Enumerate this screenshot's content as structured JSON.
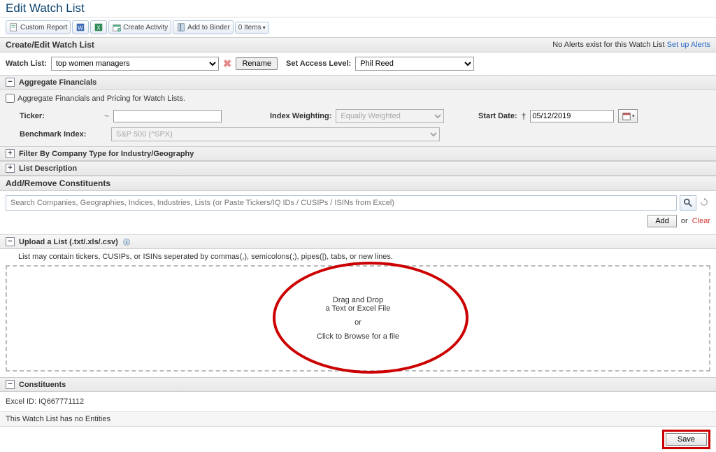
{
  "page": {
    "title": "Edit Watch List"
  },
  "toolbar": {
    "custom_report": "Custom Report",
    "create_activity": "Create Activity",
    "add_to_binder": "Add to Binder",
    "items_count": "0 Items"
  },
  "create_edit": {
    "title": "Create/Edit Watch List",
    "no_alerts": "No Alerts exist for this Watch List",
    "setup_alerts": "Set up Alerts",
    "watch_list_label": "Watch List:",
    "watch_list_value": "top women managers",
    "rename": "Rename",
    "access_level_label": "Set Access Level:",
    "access_level_value": "Phil Reed"
  },
  "agg": {
    "title": "Aggregate Financials",
    "checkbox_label": "Aggregate Financials and Pricing for Watch Lists.",
    "ticker_label": "Ticker:",
    "index_weight_label": "Index Weighting:",
    "index_weight_value": "Equally Weighted",
    "start_date_label": "Start Date:",
    "start_date_value": "05/12/2019",
    "benchmark_label": "Benchmark Index:",
    "benchmark_value": "S&P 500 (^SPX)"
  },
  "filter_section": "Filter By Company Type for Industry/Geography",
  "list_description": "List Description",
  "addrem": {
    "title": "Add/Remove Constituents",
    "search_placeholder": "Search Companies, Geographies, Indices, Industries, Lists (or Paste Tickers/IQ IDs / CUSIPs / ISINs from Excel)",
    "add": "Add",
    "or": "or",
    "clear": "Clear"
  },
  "upload": {
    "title": "Upload a List (.txt/.xls/.csv)",
    "note": "List may contain tickers, CUSIPs, or ISINs seperated by commas(,), semicolons(;), pipes(|), tabs, or new lines.",
    "drag1": "Drag and Drop",
    "drag2": "a Text or Excel File",
    "or": "or",
    "browse": "Click to Browse for a file"
  },
  "constituents": {
    "title": "Constituents",
    "excel_id_label": "Excel ID:",
    "excel_id_value": "IQ667771112",
    "empty": "This Watch List has no Entities"
  },
  "save": "Save"
}
